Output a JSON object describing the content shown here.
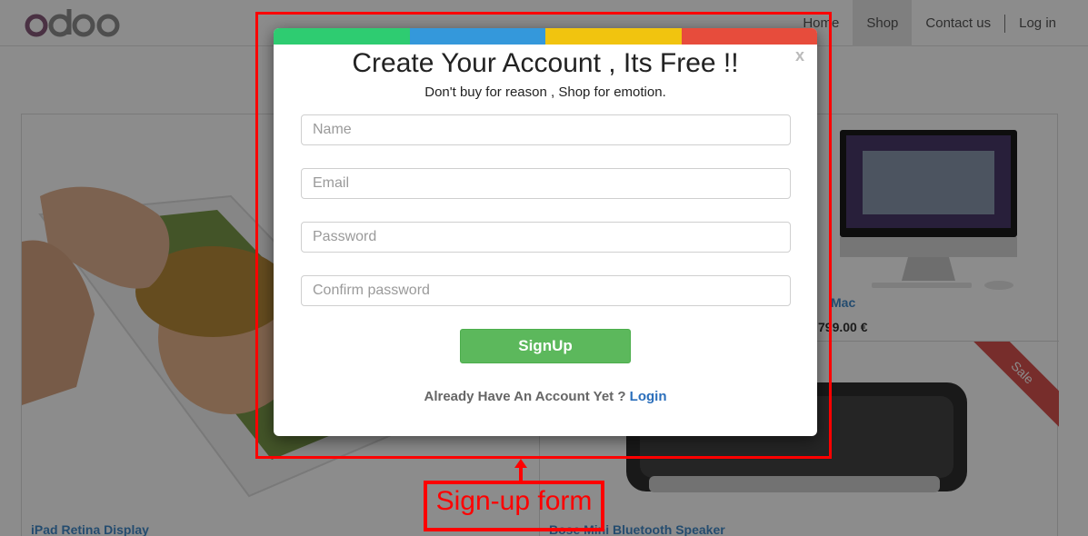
{
  "brand": {
    "logo_text": "odoo"
  },
  "nav": {
    "items": [
      {
        "label": "Home"
      },
      {
        "label": "Shop"
      },
      {
        "label": "Contact us"
      },
      {
        "label": "Log in"
      }
    ]
  },
  "products": {
    "big_name": "iPad Retina Display",
    "mac_name": "Mac",
    "mac_price": "799.00 €",
    "speaker_name": "Bose Mini Bluetooth Speaker",
    "sale_label": "Sale"
  },
  "modal": {
    "close_label": "x",
    "title": "Create Your Account , Its Free !!",
    "subtitle": "Don't buy for reason , Shop for emotion.",
    "fields": {
      "name_placeholder": "Name",
      "email_placeholder": "Email",
      "password_placeholder": "Password",
      "confirm_placeholder": "Confirm password"
    },
    "signup_label": "SignUp",
    "already_text": "Already Have An Account Yet ? ",
    "login_label": "Login",
    "colorbar": [
      "#2ecc71",
      "#3498db",
      "#f1c40f",
      "#e74c3c"
    ]
  },
  "annotation": {
    "label": "Sign-up form",
    "color": "#ff0000"
  }
}
